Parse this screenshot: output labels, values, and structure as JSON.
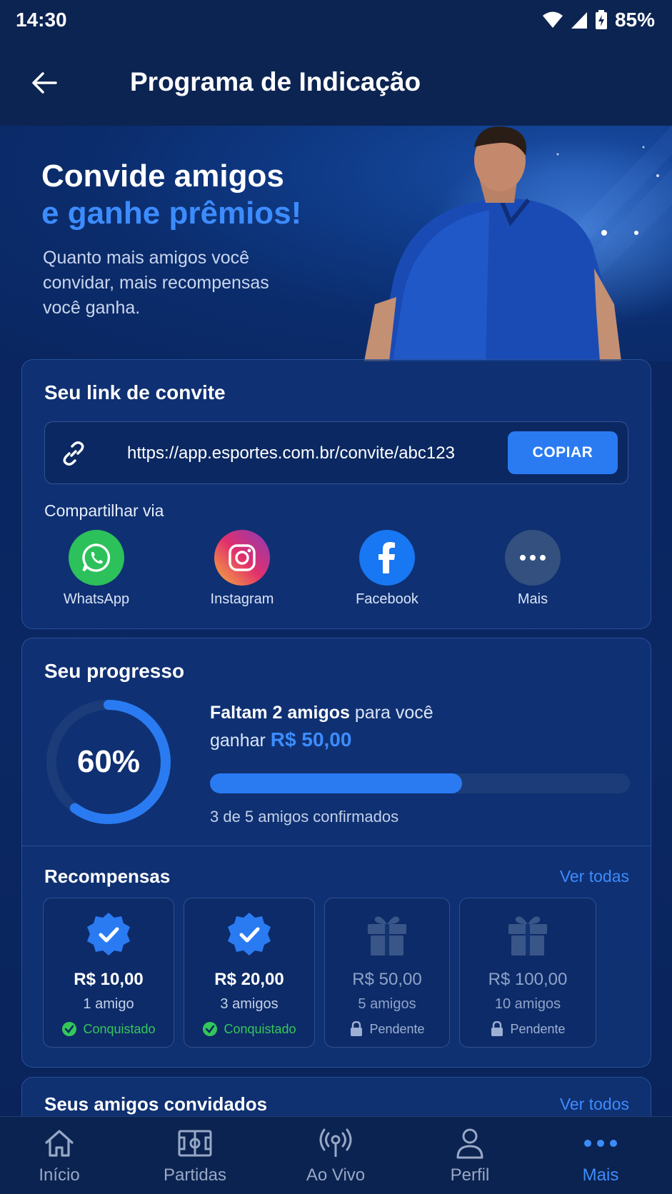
{
  "status_bar": {
    "time": "14:30",
    "battery": "85%"
  },
  "app_bar": {
    "title": "Programa de Indicação"
  },
  "hero": {
    "title_line1": "Convide amigos",
    "title_line2": "e ganhe prêmios!",
    "subtitle": "Quanto mais amigos você convidar, mais recompensas você ganha."
  },
  "invite": {
    "heading": "Seu link de convite",
    "link": "https://app.esportes.com.br/convite/abc123",
    "copy_label": "COPIAR",
    "share_label": "Compartilhar via",
    "share_options": [
      {
        "name": "WhatsApp",
        "icon": "whatsapp-icon",
        "color": "#25d366"
      },
      {
        "name": "Instagram",
        "icon": "instagram-icon",
        "color": "#e1306c"
      },
      {
        "name": "Facebook",
        "icon": "facebook-icon",
        "color": "#1877f2"
      },
      {
        "name": "Mais",
        "icon": "more-icon",
        "color": "#33507e"
      }
    ]
  },
  "progress": {
    "heading": "Seu progresso",
    "percent_label": "60%",
    "percent": 0.6,
    "missing_bold": "Faltam 2 amigos",
    "missing_rest": " para você",
    "win_prefix": "ganhar ",
    "win_amount": "R$ 50,00",
    "confirmed": "3 de 5 amigos confirmados"
  },
  "rewards": {
    "heading": "Recompensas",
    "see_all": "Ver todas",
    "items": [
      {
        "amount": "R$ 10,00",
        "friends": "1 amigo",
        "status": "Conquistado",
        "state": "done"
      },
      {
        "amount": "R$ 20,00",
        "friends": "3 amigos",
        "status": "Conquistado",
        "state": "done"
      },
      {
        "amount": "R$ 50,00",
        "friends": "5 amigos",
        "status": "Pendente",
        "state": "locked"
      },
      {
        "amount": "R$ 100,00",
        "friends": "10 amigos",
        "status": "Pendente",
        "state": "locked"
      }
    ]
  },
  "friends": {
    "heading": "Seus amigos convidados",
    "see_all": "Ver todos"
  },
  "bottom_nav": {
    "items": [
      {
        "label": "Início",
        "icon": "home-icon"
      },
      {
        "label": "Partidas",
        "icon": "field-icon"
      },
      {
        "label": "Ao Vivo",
        "icon": "live-icon"
      },
      {
        "label": "Perfil",
        "icon": "user-icon"
      },
      {
        "label": "Mais",
        "icon": "more-icon",
        "active": true
      }
    ]
  },
  "colors": {
    "accent": "#2a7bf2",
    "success": "#34c759",
    "background": "#0a2257"
  }
}
